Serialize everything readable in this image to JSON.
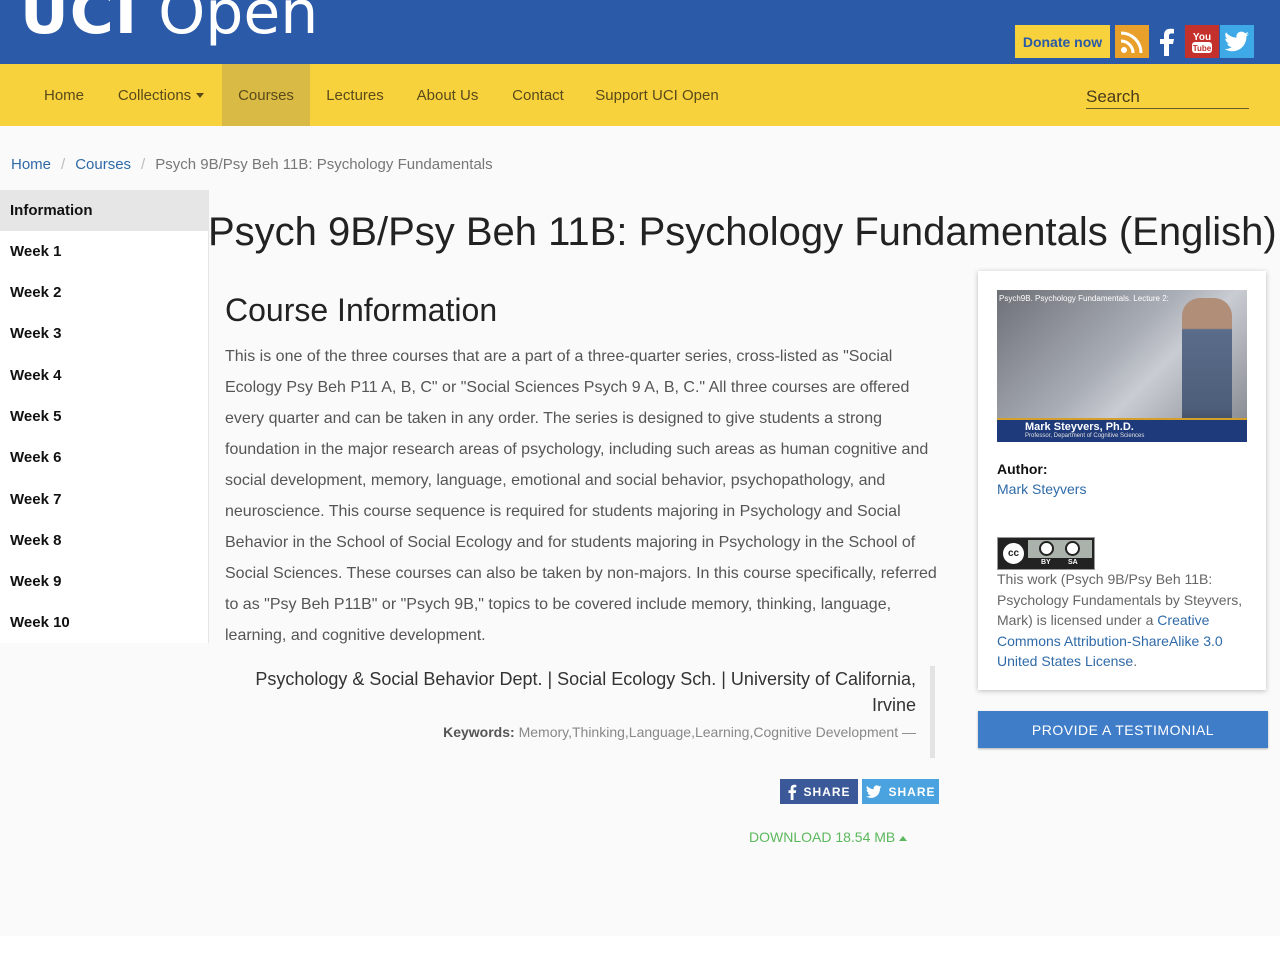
{
  "header": {
    "logo_uci": "UCI",
    "logo_open": "Open",
    "donate_label": "Donate now",
    "social": [
      "rss-icon",
      "facebook-icon",
      "youtube-icon",
      "twitter-icon"
    ],
    "brand_blue": "#2a5aa8",
    "brand_yellow": "#f7d23d"
  },
  "nav": {
    "items": [
      {
        "label": "Home"
      },
      {
        "label": "Collections"
      },
      {
        "label": "Courses",
        "active": true
      },
      {
        "label": "Lectures"
      },
      {
        "label": "About Us"
      },
      {
        "label": "Contact"
      },
      {
        "label": "Support UCI Open"
      }
    ],
    "search_placeholder": "Search"
  },
  "breadcrumb": {
    "home": "Home",
    "courses": "Courses",
    "current": "Psych 9B/Psy Beh 11B: Psychology Fundamentals"
  },
  "sidebar": {
    "items": [
      {
        "label": "Information",
        "active": true
      },
      {
        "label": "Week 1"
      },
      {
        "label": "Week 2"
      },
      {
        "label": "Week 3"
      },
      {
        "label": "Week 4"
      },
      {
        "label": "Week 5"
      },
      {
        "label": "Week 6"
      },
      {
        "label": "Week 7"
      },
      {
        "label": "Week 8"
      },
      {
        "label": "Week 9"
      },
      {
        "label": "Week 10"
      }
    ]
  },
  "main": {
    "title": "Psych 9B/Psy Beh 11B: Psychology Fundamentals (English)",
    "section_title": "Course Information",
    "description": "This is one of the three courses that are a part of a three-quarter series, cross-listed as \"Social Ecology Psy Beh P11 A, B, C\" or \"Social Sciences Psych 9 A, B, C.\" All three courses are offered every quarter and can be taken in any order. The series is designed to give students a strong foundation in the major research areas of psychology, including such areas as human cognitive and social development, memory, language, emotional and social behavior, psychopathology, and neuroscience. This course sequence is required for students majoring in Psychology and Social Behavior in the School of Social Ecology and for students majoring in Psychology in the School of Social Sciences. These courses can also be taken by non-majors. In this course specifically, referred to as \"Psy Beh P11B\" or \"Psych 9B,\" topics to be covered include memory, thinking, language, learning, and cognitive development.",
    "department": "Psychology & Social Behavior Dept. | Social Ecology Sch. | University of California, Irvine",
    "keywords_label": "Keywords:",
    "keywords": "Memory,Thinking,Language,Learning,Cognitive Development",
    "keywords_dash": "—",
    "share_facebook": "SHARE",
    "share_twitter": "SHARE",
    "download_label": "DOWNLOAD 18.54 MB"
  },
  "card": {
    "video_title": "Psych9B. Psychology Fundamentals. Lecture 2:",
    "video_name": "Mark Steyvers, Ph.D.",
    "video_subtitle": "Professor, Department of Cognitive Sciences",
    "author_label": "Author:",
    "author_name": "Mark Steyvers",
    "cc_label": "cc",
    "cc_by": "BY",
    "cc_sa": "SA",
    "license_text": "This work (Psych 9B/Psy Beh 11B: Psychology Fundamentals by Steyvers, Mark) is licensed under a",
    "license_link": "Creative Commons Attribution-ShareAlike 3.0 United States License",
    "license_end": "."
  },
  "testimonial_label": "PROVIDE A TESTIMONIAL"
}
